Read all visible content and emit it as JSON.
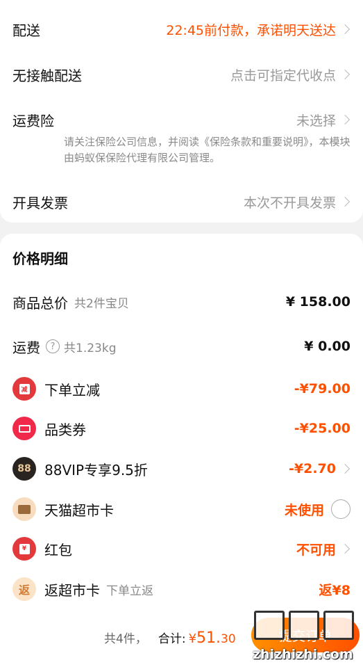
{
  "delivery": {
    "shipping": {
      "label": "配送",
      "value": "22:45前付款，承诺明天送达"
    },
    "contactless": {
      "label": "无接触配送",
      "value": "点击可指定代收点"
    },
    "insurance": {
      "label": "运费险",
      "value": "未选择",
      "note": "请关注保险公司信息，并阅读《保险条款和重要说明》，本模块由蚂蚁保保险代理有限公司管理。"
    },
    "invoice": {
      "label": "开具发票",
      "value": "本次不开具发票"
    }
  },
  "price_detail": {
    "title": "价格明细",
    "goods_total": {
      "label": "商品总价",
      "sub": "共2件宝贝",
      "value": "¥ 158.00"
    },
    "freight": {
      "label": "运费",
      "sub": "共1.23kg",
      "help_icon": "?",
      "value": "¥ 0.00"
    },
    "items": [
      {
        "label": "下单立减",
        "value": "-¥79.00",
        "icon": "instant-discount-icon",
        "icon_text": "减",
        "icon_color": "#e4393c"
      },
      {
        "label": "品类券",
        "value": "-¥25.00",
        "icon": "coupon-icon",
        "icon_color": "#f0284a"
      },
      {
        "label": "88VIP专享9.5折",
        "value": "-¥2.70",
        "icon": "vip88-icon",
        "icon_text": "88",
        "icon_color": "#2a2420"
      },
      {
        "label": "天猫超市卡",
        "value": "未使用",
        "icon": "supermarket-card-icon",
        "icon_color": "#f7dcc0"
      },
      {
        "label": "红包",
        "value": "不可用",
        "icon": "red-packet-icon",
        "icon_text": "¥",
        "icon_color": "#e4393c"
      },
      {
        "label": "返超市卡",
        "sub": "下单立返",
        "value": "返¥8",
        "icon": "cashback-icon",
        "icon_text": "返",
        "icon_color": "#fbe3c8"
      }
    ]
  },
  "bottom_bar": {
    "count": "共4件，",
    "total_label": "合计:",
    "currency": "¥",
    "total_int": "51.",
    "total_dec": "30",
    "submit_label": "提交订单"
  },
  "watermark": {
    "text": "zhizhizhi.com"
  },
  "colors": {
    "accent": "#ff5000",
    "background": "#f2f2f2"
  }
}
